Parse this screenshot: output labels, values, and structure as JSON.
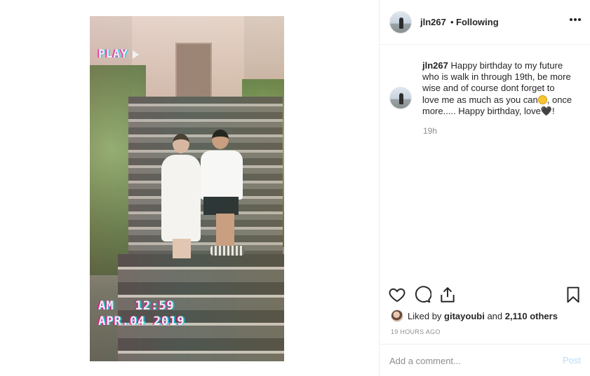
{
  "photo": {
    "overlay_play": "PLAY",
    "overlay_am": "AM",
    "overlay_clock": "12:59",
    "overlay_date": "APR.04 2019"
  },
  "header": {
    "username": "jln267",
    "separator": "•",
    "follow_status": "Following",
    "more_icon": "more-dots-icon"
  },
  "caption": {
    "username": "jln267",
    "text_part1": "Happy birthday to my future who is walk in through 19th, be more wise and of course dont forget to love me as much as you can",
    "emoji1": "smiling-face-emoji",
    "text_part2": ", once more..... Happy birthday, love",
    "emoji2": "🖤",
    "text_part3": "!",
    "time": "19h"
  },
  "actions": {
    "icons": [
      "heart-icon",
      "comment-icon",
      "share-icon",
      "bookmark-icon"
    ]
  },
  "likes": {
    "prefix": "Liked by",
    "user": "gitayoubi",
    "middle": "and",
    "count": "2,110 others"
  },
  "timestamp": "19 HOURS AGO",
  "comment_box": {
    "placeholder": "Add a comment...",
    "post_label": "Post"
  },
  "colors": {
    "text": "#262626",
    "muted": "#8e8e8e",
    "post_disabled": "#b9dcfa",
    "border": "#efefef"
  }
}
